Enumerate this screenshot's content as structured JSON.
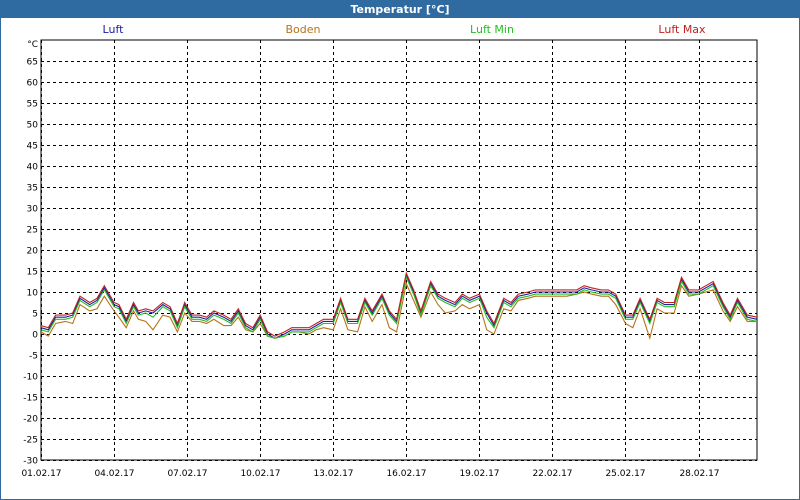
{
  "window": {
    "title": "Temperatur [°C]"
  },
  "colors": {
    "title_bar": "#2f6aa0",
    "grid": "#000000",
    "background": "#ffffff"
  },
  "chart_data": {
    "type": "line",
    "title": "Temperatur [°C]",
    "ylabel": "°C",
    "ylim": [
      -30,
      70
    ],
    "yticks": [
      65,
      60,
      55,
      50,
      45,
      40,
      35,
      30,
      25,
      20,
      15,
      10,
      5,
      0,
      -5,
      -10,
      -15,
      -20,
      -25,
      -30
    ],
    "xlim": [
      0,
      29.4
    ],
    "xticks": [
      {
        "x": 0,
        "label": "01.02.17"
      },
      {
        "x": 3,
        "label": "04.02.17"
      },
      {
        "x": 6,
        "label": "07.02.17"
      },
      {
        "x": 9,
        "label": "10.02.17"
      },
      {
        "x": 12,
        "label": "13.02.17"
      },
      {
        "x": 15,
        "label": "16.02.17"
      },
      {
        "x": 18,
        "label": "19.02.17"
      },
      {
        "x": 21,
        "label": "22.02.17"
      },
      {
        "x": 24,
        "label": "25.02.17"
      },
      {
        "x": 27,
        "label": "28.02.17"
      }
    ],
    "grid": true,
    "legend_position": "top",
    "x": [
      0,
      0.3,
      0.6,
      1.0,
      1.3,
      1.6,
      2.0,
      2.3,
      2.6,
      3.0,
      3.2,
      3.5,
      3.8,
      4.0,
      4.3,
      4.6,
      5.0,
      5.3,
      5.6,
      5.9,
      6.2,
      6.5,
      6.8,
      7.1,
      7.5,
      7.8,
      8.1,
      8.4,
      8.7,
      9.0,
      9.3,
      9.6,
      10.0,
      10.3,
      10.6,
      11.0,
      11.3,
      11.6,
      12.0,
      12.3,
      12.6,
      13.0,
      13.3,
      13.6,
      14.0,
      14.3,
      14.6,
      15.0,
      15.3,
      15.6,
      16.0,
      16.3,
      16.6,
      17.0,
      17.3,
      17.6,
      18.0,
      18.3,
      18.6,
      19.0,
      19.3,
      19.6,
      20.0,
      20.3,
      20.6,
      21.0,
      21.3,
      21.6,
      22.0,
      22.3,
      22.6,
      23.0,
      23.3,
      23.6,
      24.0,
      24.3,
      24.6,
      25.0,
      25.3,
      25.6,
      26.0,
      26.3,
      26.6,
      27.0,
      27.3,
      27.6,
      28.0,
      28.3,
      28.6,
      29.0,
      29.4
    ],
    "series": [
      {
        "name": "Luft",
        "color": "#2020a0",
        "values": [
          1.5,
          1,
          4,
          4,
          4.5,
          8.5,
          7,
          8,
          11,
          7,
          6.5,
          3,
          7,
          5,
          5.5,
          5,
          7,
          6,
          2,
          7,
          4,
          4,
          3.5,
          5,
          4,
          3,
          5.5,
          2,
          1,
          4,
          0,
          -1,
          0,
          1,
          1,
          1,
          2,
          3,
          3,
          8,
          3,
          3,
          8,
          5,
          9,
          5,
          3,
          14,
          10,
          5,
          12,
          9,
          8,
          7,
          9,
          8,
          9,
          5,
          2,
          8,
          7,
          9,
          9.5,
          10,
          10,
          10,
          10,
          10,
          10,
          11,
          10.5,
          10,
          10,
          9,
          4,
          4,
          8,
          3,
          8,
          7,
          7,
          13,
          10,
          10,
          11,
          12,
          7,
          4,
          8,
          4,
          3.5
        ]
      },
      {
        "name": "Boden",
        "color": "#b8721b",
        "values": [
          0.5,
          -0.5,
          2.5,
          3,
          2.5,
          7,
          5.5,
          6,
          9,
          5.5,
          4,
          1.5,
          5.5,
          3.5,
          3,
          1,
          4.5,
          4,
          0.5,
          5,
          3,
          3,
          2.5,
          3.5,
          2,
          2,
          4,
          1,
          0.5,
          2.5,
          -0.5,
          -1,
          -0.5,
          0.5,
          0.5,
          0,
          1,
          1.5,
          1,
          6,
          1,
          0.5,
          6.5,
          3,
          7,
          1.5,
          0.5,
          12,
          8,
          4,
          10,
          7,
          5,
          5.5,
          7,
          6,
          7,
          1,
          0,
          6,
          5.5,
          8,
          8.5,
          9,
          9,
          9,
          9,
          9,
          9.5,
          10,
          9.5,
          9,
          9,
          7,
          2.5,
          1.5,
          6,
          -1,
          6,
          5,
          5,
          11.5,
          9,
          9.5,
          10,
          10.5,
          5.5,
          3,
          6.5,
          3,
          3
        ]
      },
      {
        "name": "Luft Min",
        "color": "#22c022",
        "values": [
          1,
          0.5,
          3.5,
          3.5,
          4,
          8,
          6.5,
          7.5,
          10.5,
          6.5,
          6,
          2.5,
          6.5,
          4.5,
          5,
          4,
          6.5,
          5.5,
          1.5,
          6.5,
          3.5,
          3.5,
          3,
          4.5,
          3.5,
          2.5,
          5,
          1.5,
          0.5,
          3.5,
          -0.5,
          -1,
          -0.5,
          0.5,
          0.5,
          0.5,
          1.5,
          2.5,
          2.5,
          7.5,
          2.5,
          2.5,
          7.5,
          4.5,
          8.5,
          4.5,
          2.5,
          13.5,
          9.5,
          4.5,
          11.5,
          8.5,
          7.5,
          6.5,
          8.5,
          7.5,
          8.5,
          4,
          1.5,
          7.5,
          6.5,
          8.5,
          9,
          9.5,
          9.5,
          9.5,
          9.5,
          9.5,
          9.5,
          10.5,
          10,
          9.5,
          9.5,
          8.5,
          3.5,
          3.5,
          7.5,
          2.5,
          7.5,
          6.5,
          6.5,
          12.5,
          9.5,
          9.5,
          10.5,
          11.5,
          6.5,
          3.5,
          7.5,
          3.5,
          3
        ]
      },
      {
        "name": "Luft Max",
        "color": "#c02020",
        "values": [
          2,
          1.5,
          4.5,
          4.5,
          5,
          9,
          7.5,
          8.5,
          11.5,
          7.5,
          7,
          3.5,
          7.5,
          5.5,
          6,
          5.5,
          7.5,
          6.5,
          2.5,
          7.5,
          4.5,
          4.5,
          4,
          5.5,
          4.5,
          3.5,
          6,
          2.5,
          1.5,
          4.5,
          0.5,
          -0.5,
          0.5,
          1.5,
          1.5,
          1.5,
          2.5,
          3.5,
          3.5,
          8.5,
          3.5,
          3.5,
          8.5,
          5.5,
          9.5,
          5.5,
          3.5,
          14.5,
          10.5,
          5.5,
          12.5,
          9.5,
          8.5,
          7.5,
          9.5,
          8.5,
          9.5,
          5.5,
          2.5,
          8.5,
          7.5,
          9.5,
          10,
          10.5,
          10.5,
          10.5,
          10.5,
          10.5,
          10.5,
          11.5,
          11,
          10.5,
          10.5,
          9.5,
          4.5,
          4.5,
          8.5,
          3.5,
          8.5,
          7.5,
          7.5,
          13.5,
          10.5,
          10.5,
          11.5,
          12.5,
          7.5,
          4.5,
          8.5,
          4.5,
          4
        ]
      }
    ]
  }
}
